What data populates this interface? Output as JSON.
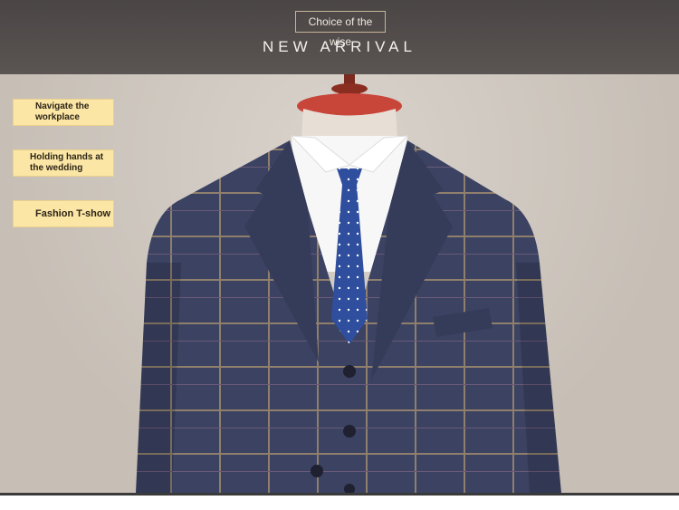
{
  "banner": {
    "tagline": "Choice of the wise",
    "headline": "NEW ARRIVAL"
  },
  "occasions": [
    "Navigate the workplace",
    "Holding hands at the wedding",
    "Fashion T-show"
  ],
  "colors": {
    "header": "#4f4a48",
    "background": "#cfc8c0",
    "label_fill": "#fbe6a5",
    "suit": "#3b4262",
    "tie": "#2f4f9e"
  },
  "icons": [
    "mannequin-image"
  ]
}
